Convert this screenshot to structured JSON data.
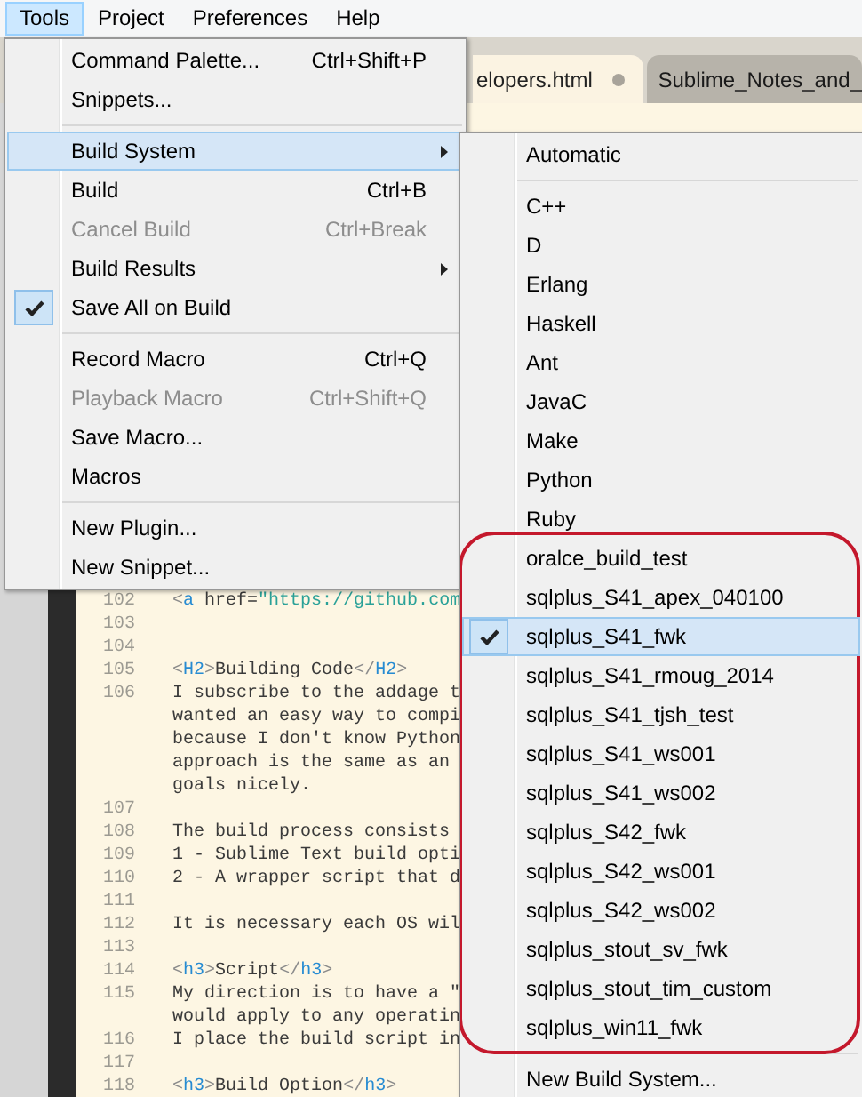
{
  "menu_bar": [
    {
      "label": "Tools",
      "selected": true
    },
    {
      "label": "Project",
      "selected": false
    },
    {
      "label": "Preferences",
      "selected": false
    },
    {
      "label": "Help",
      "selected": false
    }
  ],
  "tabs": [
    {
      "label": "elopers.html",
      "selected": true,
      "modified": true
    },
    {
      "label": "Sublime_Notes_and_",
      "selected": false
    }
  ],
  "editor": {
    "lines": [
      {
        "number": "102",
        "rows": [
          "<a href=\"https://github.com"
        ]
      },
      {
        "number": "103"
      },
      {
        "number": "104"
      },
      {
        "number": "105",
        "rows": [
          "<H2>Building Code</H2>"
        ]
      },
      {
        "number": "106",
        "rows": [
          "I subscribe to the addage t",
          "wanted an easy way to compi",
          "because I don't know Python",
          "approach is the same as an",
          "goals nicely."
        ]
      },
      {
        "number": "107"
      },
      {
        "number": "108",
        "rows": [
          "The build process consists"
        ]
      },
      {
        "number": "109",
        "rows": [
          "1 - Sublime Text build opti"
        ]
      },
      {
        "number": "110",
        "rows": [
          "2 - A wrapper script that d"
        ]
      },
      {
        "number": "111"
      },
      {
        "number": "112",
        "rows": [
          "It is necessary each OS wil"
        ]
      },
      {
        "number": "113"
      },
      {
        "number": "114",
        "rows": [
          "<h3>Script</h3>"
        ]
      },
      {
        "number": "115",
        "rows": [
          "My direction is to have a \"",
          "would apply to any operatin"
        ]
      },
      {
        "number": "116",
        "rows": [
          "I place the build script in"
        ]
      },
      {
        "number": "117"
      },
      {
        "number": "118",
        "rows": [
          "<h3>Build Option</h3>"
        ]
      }
    ]
  },
  "tools_menu": {
    "groups": [
      {
        "divider": false,
        "items": [
          {
            "label": "Command Palette...",
            "shortcut": "Ctrl+Shift+P",
            "submenu": false,
            "disabled": false,
            "checked": false,
            "selected": false
          },
          {
            "label": "Snippets...",
            "submenu": false,
            "disabled": false,
            "checked": false,
            "selected": false
          }
        ]
      },
      {
        "divider": true,
        "items": [
          {
            "label": "Build System",
            "submenu": true,
            "disabled": false,
            "checked": false,
            "selected": true
          },
          {
            "label": "Build",
            "shortcut": "Ctrl+B",
            "submenu": false,
            "disabled": false,
            "checked": false,
            "selected": false
          },
          {
            "label": "Cancel Build",
            "shortcut": "Ctrl+Break",
            "submenu": false,
            "disabled": true,
            "checked": false,
            "selected": false
          },
          {
            "label": "Build Results",
            "submenu": true,
            "disabled": false,
            "checked": false,
            "selected": false
          },
          {
            "label": "Save All on Build",
            "submenu": false,
            "disabled": false,
            "checked": true,
            "selected": false
          }
        ]
      },
      {
        "divider": true,
        "items": [
          {
            "label": "Record Macro",
            "shortcut": "Ctrl+Q",
            "submenu": false,
            "disabled": false,
            "checked": false,
            "selected": false
          },
          {
            "label": "Playback Macro",
            "shortcut": "Ctrl+Shift+Q",
            "submenu": false,
            "disabled": true,
            "checked": false,
            "selected": false
          },
          {
            "label": "Save Macro...",
            "submenu": false,
            "disabled": false,
            "checked": false,
            "selected": false
          },
          {
            "label": "Macros",
            "submenu": false,
            "disabled": false,
            "checked": false,
            "selected": false
          }
        ]
      },
      {
        "divider": true,
        "items": [
          {
            "label": "New Plugin...",
            "submenu": false,
            "disabled": false,
            "checked": false,
            "selected": false
          },
          {
            "label": "New Snippet...",
            "submenu": false,
            "disabled": false,
            "checked": false,
            "selected": false
          }
        ]
      }
    ]
  },
  "build_system_menu": {
    "groups": [
      {
        "divider": false,
        "outlined": false,
        "items": [
          {
            "label": "Automatic",
            "checked": false,
            "selected": false
          }
        ]
      },
      {
        "divider": true,
        "outlined": false,
        "items": [
          {
            "label": "C++",
            "checked": false,
            "selected": false
          },
          {
            "label": "D",
            "checked": false,
            "selected": false
          },
          {
            "label": "Erlang",
            "checked": false,
            "selected": false
          },
          {
            "label": "Haskell",
            "checked": false,
            "selected": false
          },
          {
            "label": "Ant",
            "checked": false,
            "selected": false
          },
          {
            "label": "JavaC",
            "checked": false,
            "selected": false
          },
          {
            "label": "Make",
            "checked": false,
            "selected": false
          },
          {
            "label": "Python",
            "checked": false,
            "selected": false
          },
          {
            "label": "Ruby",
            "checked": false,
            "selected": false
          }
        ]
      },
      {
        "divider": false,
        "outlined": true,
        "items": [
          {
            "label": "oralce_build_test",
            "checked": false,
            "selected": false
          },
          {
            "label": "sqlplus_S41_apex_040100",
            "checked": false,
            "selected": false
          },
          {
            "label": "sqlplus_S41_fwk",
            "checked": true,
            "selected": true
          },
          {
            "label": "sqlplus_S41_rmoug_2014",
            "checked": false,
            "selected": false
          },
          {
            "label": "sqlplus_S41_tjsh_test",
            "checked": false,
            "selected": false
          },
          {
            "label": "sqlplus_S41_ws001",
            "checked": false,
            "selected": false
          },
          {
            "label": "sqlplus_S41_ws002",
            "checked": false,
            "selected": false
          },
          {
            "label": "sqlplus_S42_fwk",
            "checked": false,
            "selected": false
          },
          {
            "label": "sqlplus_S42_ws001",
            "checked": false,
            "selected": false
          },
          {
            "label": "sqlplus_S42_ws002",
            "checked": false,
            "selected": false
          },
          {
            "label": "sqlplus_stout_sv_fwk",
            "checked": false,
            "selected": false
          },
          {
            "label": "sqlplus_stout_tim_custom",
            "checked": false,
            "selected": false
          },
          {
            "label": "sqlplus_win11_fwk",
            "checked": false,
            "selected": false
          }
        ]
      },
      {
        "divider": true,
        "outlined": false,
        "items": [
          {
            "label": "New Build System...",
            "checked": false,
            "selected": false
          }
        ]
      }
    ]
  }
}
